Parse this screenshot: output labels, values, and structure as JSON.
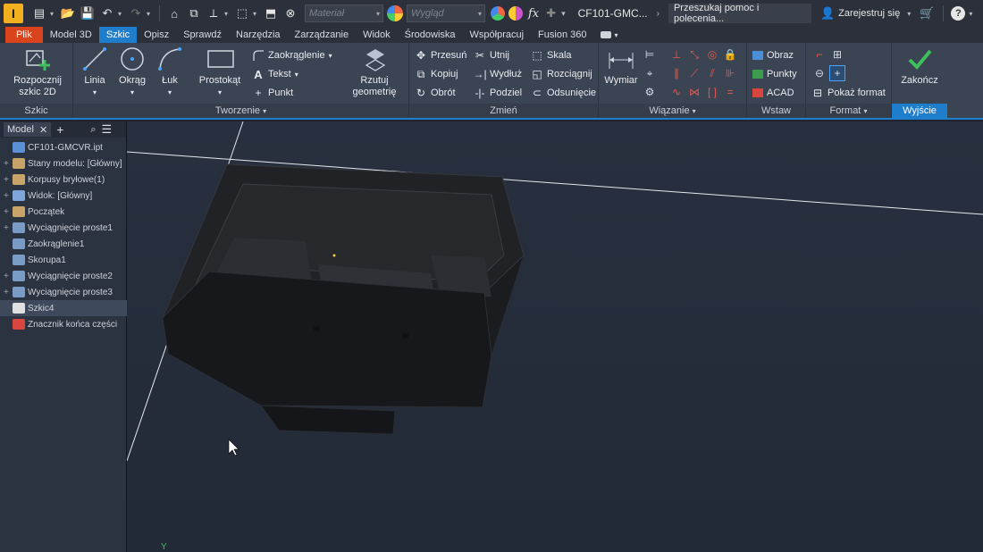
{
  "titlebar": {
    "material_placeholder": "Materiał",
    "appearance_placeholder": "Wygląd",
    "fx_label": "fx",
    "document_title": "CF101-GMC...",
    "search_placeholder": "Przeszukaj pomoc i polecenia...",
    "signin_label": "Zarejestruj się",
    "help_label": "?"
  },
  "tabs": [
    {
      "label": "Plik"
    },
    {
      "label": "Model 3D"
    },
    {
      "label": "Szkic"
    },
    {
      "label": "Opisz"
    },
    {
      "label": "Sprawdź"
    },
    {
      "label": "Narzędzia"
    },
    {
      "label": "Zarządzanie"
    },
    {
      "label": "Widok"
    },
    {
      "label": "Środowiska"
    },
    {
      "label": "Współpracuj"
    },
    {
      "label": "Fusion 360"
    }
  ],
  "ribbon": {
    "szkic": {
      "label": "Szkic",
      "start_sketch": "Rozpocznij szkic 2D"
    },
    "tworzenie": {
      "label": "Tworzenie",
      "line": "Linia",
      "circle": "Okrąg",
      "arc": "Łuk",
      "rectangle": "Prostokąt",
      "fillet": "Zaokrąglenie",
      "text": "Tekst",
      "point": "Punkt",
      "project": "Rzutuj geometrię"
    },
    "zmien": {
      "label": "Zmień",
      "move": "Przesuń",
      "copy": "Kopiuj",
      "rotate": "Obrót",
      "trim": "Utnij",
      "extend": "Wydłuż",
      "split": "Podziel",
      "scale": "Skala",
      "stretch": "Rozciągnij",
      "offset": "Odsunięcie"
    },
    "wiazanie": {
      "label": "Wiązanie",
      "dimension": "Wymiar"
    },
    "wstaw": {
      "label": "Wstaw",
      "image": "Obraz",
      "points": "Punkty",
      "acad": "ACAD"
    },
    "format": {
      "label": "Format",
      "show_format": "Pokaż format"
    },
    "wyjscie": {
      "label": "Wyjście",
      "finish": "Zakończ"
    }
  },
  "browser": {
    "tab_label": "Model",
    "nodes": [
      {
        "label": "CF101-GMCVR.ipt",
        "expandable": false,
        "color": "#5b8fd6"
      },
      {
        "label": "Stany modelu: [Główny]",
        "expandable": true,
        "color": "#c8a46a"
      },
      {
        "label": "Korpusy bryłowe(1)",
        "expandable": true,
        "color": "#c8a46a"
      },
      {
        "label": "Widok: [Główny]",
        "expandable": true,
        "color": "#7ea6d8"
      },
      {
        "label": "Początek",
        "expandable": true,
        "color": "#c8a46a"
      },
      {
        "label": "Wyciągnięcie proste1",
        "expandable": true,
        "color": "#7a9cc4"
      },
      {
        "label": "Zaokrąglenie1",
        "expandable": false,
        "color": "#7a9cc4"
      },
      {
        "label": "Skorupa1",
        "expandable": false,
        "color": "#7a9cc4"
      },
      {
        "label": "Wyciągnięcie proste2",
        "expandable": true,
        "color": "#7a9cc4"
      },
      {
        "label": "Wyciągnięcie proste3",
        "expandable": true,
        "color": "#7a9cc4"
      },
      {
        "label": "Szkic4",
        "expandable": false,
        "color": "#e0e0e0",
        "selected": true
      },
      {
        "label": "Znacznik końca części",
        "expandable": false,
        "color": "#d9463f"
      }
    ]
  },
  "viewport": {
    "axis_label": "Y"
  },
  "colors": {
    "accent": "#1f7ecb",
    "file_tab": "#d9441c",
    "finish_check": "#3fbf5b"
  }
}
